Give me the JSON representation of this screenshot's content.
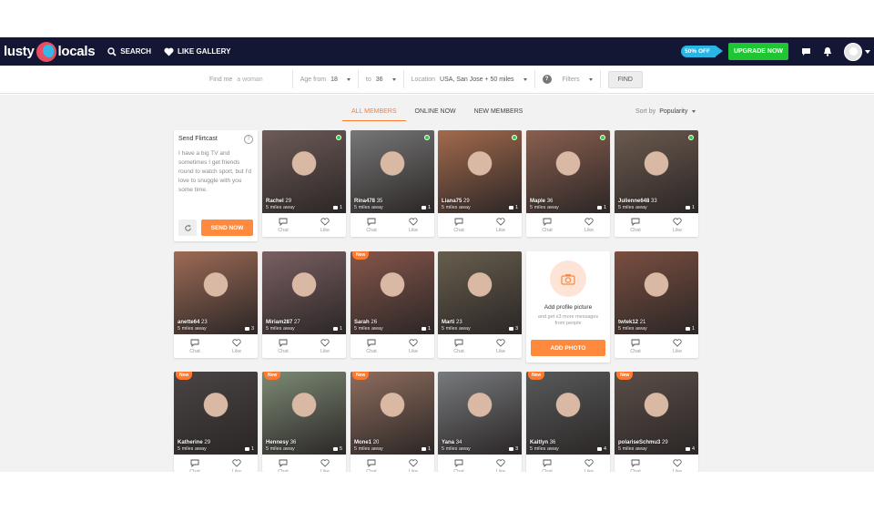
{
  "nav": {
    "logo_left": "lusty",
    "logo_right": "locals",
    "search_label": "SEARCH",
    "like_gallery_label": "LIKE GALLERY",
    "promo_label": "50% OFF",
    "upgrade_label": "UPGRADE NOW"
  },
  "filters": {
    "find_me_label": "Find me",
    "find_me_value": "a woman",
    "age_from_label": "Age from",
    "age_from_value": "18",
    "age_to_label": "to",
    "age_to_value": "36",
    "location_label": "Location",
    "location_value": "USA, San Jose + 50 miles",
    "help_glyph": "?",
    "filters_label": "Filters",
    "find_label": "FIND"
  },
  "tabs": [
    "ALL MEMBERS",
    "ONLINE NOW",
    "NEW MEMBERS"
  ],
  "sort": {
    "label": "Sort by",
    "value": "Popularity"
  },
  "flirtcast": {
    "title": "Send Flirtcast",
    "help_glyph": "?",
    "message": "I have a big TV and sometimes I get friends round to watch sport, but I'd love to snuggle with you some time.",
    "send_label": "SEND NOW"
  },
  "add_photo": {
    "title": "Add profile picture",
    "subtitle": "and get x3 more messages from people",
    "button_label": "ADD PHOTO"
  },
  "actions": {
    "chat": "Chat",
    "like": "Like"
  },
  "new_badge": "New",
  "members": [
    {
      "name": "Rachel",
      "age": "29",
      "distance": "5 miles away",
      "photos": "1",
      "online": true,
      "new": false,
      "color": "#6d5b57"
    },
    {
      "name": "Rina478",
      "age": "35",
      "distance": "5 miles away",
      "photos": "1",
      "online": true,
      "new": false,
      "color": "#777777"
    },
    {
      "name": "Liana75",
      "age": "29",
      "distance": "5 miles away",
      "photos": "1",
      "online": true,
      "new": false,
      "color": "#a36a4c"
    },
    {
      "name": "Maple",
      "age": "36",
      "distance": "5 miles away",
      "photos": "1",
      "online": true,
      "new": false,
      "color": "#8a5f4f"
    },
    {
      "name": "Julienne648",
      "age": "33",
      "distance": "5 miles away",
      "photos": "1",
      "online": true,
      "new": false,
      "color": "#6b5a4e"
    },
    {
      "name": "anette64",
      "age": "23",
      "distance": "5 miles away",
      "photos": "3",
      "online": false,
      "new": false,
      "color": "#9d6b55"
    },
    {
      "name": "Miriam287",
      "age": "27",
      "distance": "5 miles away",
      "photos": "1",
      "online": false,
      "new": false,
      "color": "#7a5f62"
    },
    {
      "name": "Sarah",
      "age": "26",
      "distance": "5 miles away",
      "photos": "1",
      "online": false,
      "new": true,
      "color": "#86564a"
    },
    {
      "name": "Marti",
      "age": "23",
      "distance": "5 miles away",
      "photos": "3",
      "online": false,
      "new": false,
      "color": "#675e4d"
    },
    {
      "name": "twtek12",
      "age": "21",
      "distance": "5 miles away",
      "photos": "1",
      "online": false,
      "new": false,
      "color": "#7a4f40"
    },
    {
      "name": "Katherine",
      "age": "29",
      "distance": "5 miles away",
      "photos": "1",
      "online": false,
      "new": true,
      "color": "#4a4444"
    },
    {
      "name": "Hennesy",
      "age": "36",
      "distance": "5 miles away",
      "photos": "5",
      "online": false,
      "new": true,
      "color": "#7c8a74"
    },
    {
      "name": "Mone1",
      "age": "20",
      "distance": "5 miles away",
      "photos": "1",
      "online": false,
      "new": true,
      "color": "#8e6d5d"
    },
    {
      "name": "Yana",
      "age": "34",
      "distance": "5 miles away",
      "photos": "3",
      "online": false,
      "new": false,
      "color": "#777a7d"
    },
    {
      "name": "Kaitlyn",
      "age": "36",
      "distance": "5 miles away",
      "photos": "4",
      "online": false,
      "new": true,
      "color": "#585a5a"
    },
    {
      "name": "polariseSchmu3",
      "age": "29",
      "distance": "5 miles away",
      "photos": "4",
      "online": false,
      "new": true,
      "color": "#5a4e48"
    }
  ],
  "colors": {
    "navbar": "#131733",
    "accent": "#ff7a2e",
    "upgrade": "#1ec633",
    "promo": "#29b6e6",
    "online": "#2fd13a"
  }
}
